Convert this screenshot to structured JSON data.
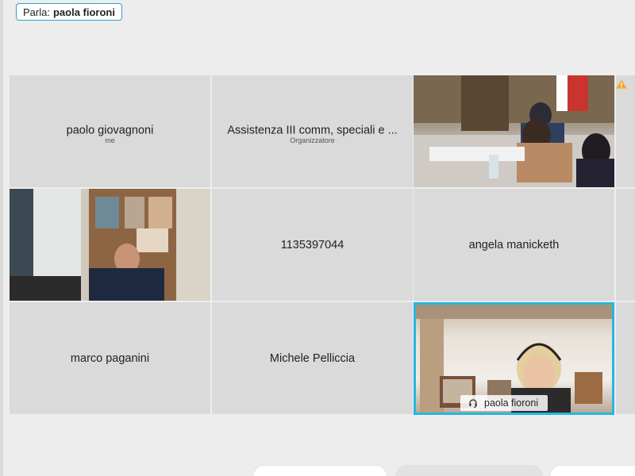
{
  "speaking": {
    "label": "Parla:",
    "name": "paola fioroni"
  },
  "participants": [
    {
      "name": "paolo giovagnoni",
      "role": "me"
    },
    {
      "name": "Assistenza III comm, speciali e ...",
      "role": "Organizzatore"
    },
    {
      "name": "",
      "role": ""
    },
    {
      "name": "",
      "role": ""
    },
    {
      "name": "1135397044",
      "role": ""
    },
    {
      "name": "angela manicketh",
      "role": ""
    },
    {
      "name": "marco paganini",
      "role": ""
    },
    {
      "name": "Michele Pelliccia",
      "role": ""
    },
    {
      "name": "paola fioroni",
      "role": ""
    }
  ],
  "icons": {
    "warning": "warning-icon",
    "headset": "headset-icon"
  },
  "colors": {
    "active_border": "#26b6e0",
    "speaking_border": "#2a9fd6",
    "warning": "#f5a623"
  }
}
